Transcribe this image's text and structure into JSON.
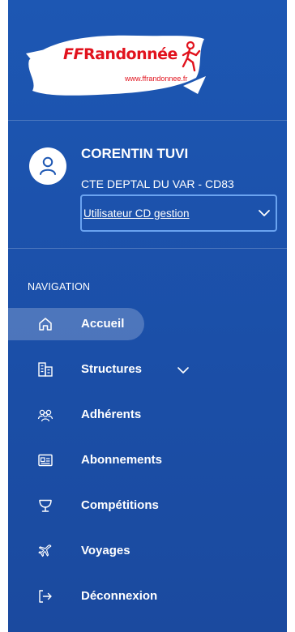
{
  "logo": {
    "brand_prefix": "FF",
    "brand_name": "Randonnée",
    "url": "www.ffrandonnee.fr",
    "colors": {
      "brand_red": "#e1121d"
    }
  },
  "user": {
    "name": "CORENTIN TUVI",
    "organization": "CTE DEPTAL DU VAR - CD83",
    "role_selected": "Utilisateur CD gestion",
    "avatar_icon": "user-icon"
  },
  "navigation": {
    "heading": "NAVIGATION",
    "items": [
      {
        "label": "Accueil",
        "icon": "home-icon",
        "active": true
      },
      {
        "label": "Structures",
        "icon": "buildings-icon",
        "expandable": true
      },
      {
        "label": "Adhérents",
        "icon": "users-icon"
      },
      {
        "label": "Abonnements",
        "icon": "id-card-icon"
      },
      {
        "label": "Compétitions",
        "icon": "trophy-icon"
      },
      {
        "label": "Voyages",
        "icon": "plane-icon"
      },
      {
        "label": "Déconnexion",
        "icon": "logout-icon"
      }
    ]
  },
  "colors": {
    "sidebar_bg": "#1d57b3",
    "select_border": "#6aa3f0",
    "text": "#ffffff"
  }
}
